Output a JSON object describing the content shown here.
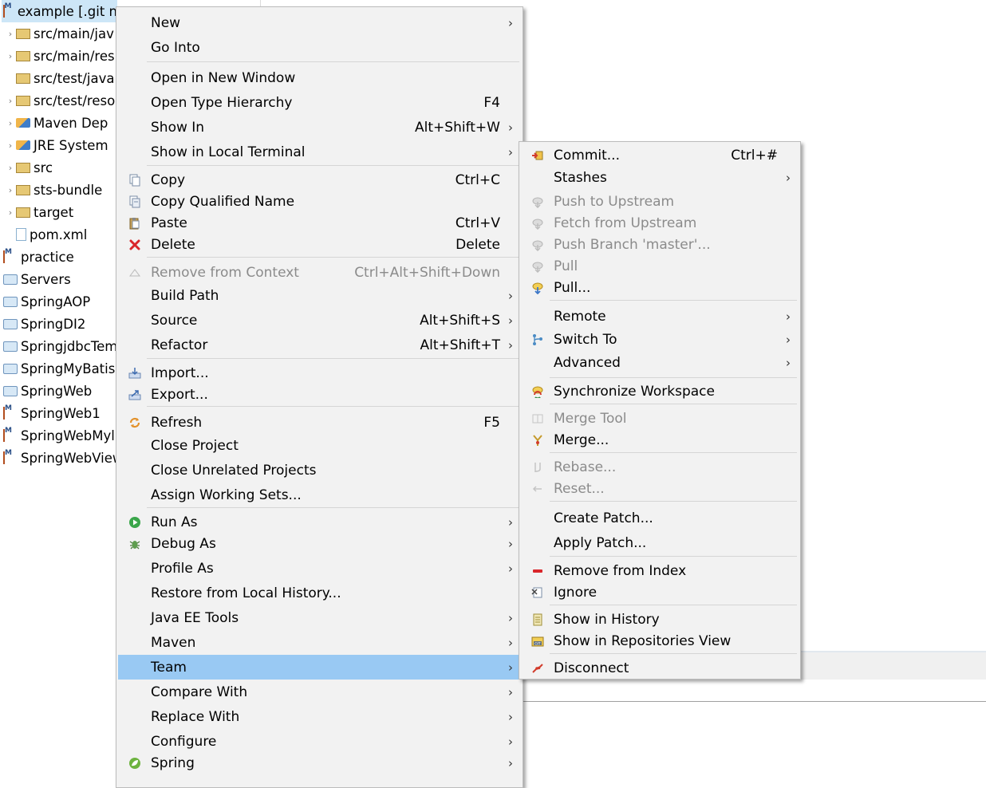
{
  "project_explorer": {
    "items": [
      {
        "label": "example [.git n",
        "kind": "maven",
        "expand": "",
        "selected": true
      },
      {
        "label": "src/main/jav",
        "kind": "folder",
        "expand": "›"
      },
      {
        "label": "src/main/res",
        "kind": "folder",
        "expand": "›"
      },
      {
        "label": "src/test/java",
        "kind": "folder",
        "expand": ""
      },
      {
        "label": "src/test/reso",
        "kind": "folder",
        "expand": "›"
      },
      {
        "label": "Maven Dep",
        "kind": "lib",
        "expand": "›"
      },
      {
        "label": "JRE System",
        "kind": "lib",
        "expand": "›"
      },
      {
        "label": "src",
        "kind": "folder",
        "expand": "›"
      },
      {
        "label": "sts-bundle",
        "kind": "folder",
        "expand": "›"
      },
      {
        "label": "target",
        "kind": "folder",
        "expand": "›"
      },
      {
        "label": "pom.xml",
        "kind": "file",
        "expand": ""
      },
      {
        "label": "practice",
        "kind": "maven",
        "expand": ""
      },
      {
        "label": "Servers",
        "kind": "project",
        "expand": ""
      },
      {
        "label": "SpringAOP",
        "kind": "project",
        "expand": ""
      },
      {
        "label": "SpringDI2",
        "kind": "project",
        "expand": ""
      },
      {
        "label": "SpringjdbcTem",
        "kind": "project",
        "expand": ""
      },
      {
        "label": "SpringMyBatis",
        "kind": "project",
        "expand": ""
      },
      {
        "label": "SpringWeb",
        "kind": "project",
        "expand": ""
      },
      {
        "label": "SpringWeb1",
        "kind": "maven",
        "expand": ""
      },
      {
        "label": "SpringWebMyl",
        "kind": "maven",
        "expand": ""
      },
      {
        "label": "SpringWebView",
        "kind": "maven",
        "expand": ""
      }
    ]
  },
  "context_menu": {
    "items": [
      {
        "label": "New",
        "submenu": true
      },
      {
        "label": "Go Into"
      },
      {
        "label": "Open in New Window"
      },
      {
        "label": "Open Type Hierarchy",
        "shortcut": "F4"
      },
      {
        "label": "Show In",
        "shortcut": "Alt+Shift+W",
        "submenu": true
      },
      {
        "label": "Show in Local Terminal",
        "submenu": true
      },
      {
        "label": "Copy",
        "shortcut": "Ctrl+C",
        "icon": "copy-icon"
      },
      {
        "label": "Copy Qualified Name",
        "icon": "copy-qualified-icon"
      },
      {
        "label": "Paste",
        "shortcut": "Ctrl+V",
        "icon": "paste-icon"
      },
      {
        "label": "Delete",
        "shortcut": "Delete",
        "icon": "delete-icon"
      },
      {
        "label": "Remove from Context",
        "shortcut": "Ctrl+Alt+Shift+Down",
        "icon": "remove-context-icon",
        "disabled": true
      },
      {
        "label": "Build Path",
        "submenu": true
      },
      {
        "label": "Source",
        "shortcut": "Alt+Shift+S",
        "submenu": true
      },
      {
        "label": "Refactor",
        "shortcut": "Alt+Shift+T",
        "submenu": true
      },
      {
        "label": "Import...",
        "icon": "import-icon"
      },
      {
        "label": "Export...",
        "icon": "export-icon"
      },
      {
        "label": "Refresh",
        "shortcut": "F5",
        "icon": "refresh-icon"
      },
      {
        "label": "Close Project"
      },
      {
        "label": "Close Unrelated Projects"
      },
      {
        "label": "Assign Working Sets..."
      },
      {
        "label": "Run As",
        "submenu": true,
        "icon": "run-icon"
      },
      {
        "label": "Debug As",
        "submenu": true,
        "icon": "debug-icon"
      },
      {
        "label": "Profile As",
        "submenu": true
      },
      {
        "label": "Restore from Local History..."
      },
      {
        "label": "Java EE Tools",
        "submenu": true
      },
      {
        "label": "Maven",
        "submenu": true
      },
      {
        "label": "Team",
        "submenu": true,
        "highlighted": true
      },
      {
        "label": "Compare With",
        "submenu": true
      },
      {
        "label": "Replace With",
        "submenu": true
      },
      {
        "label": "Configure",
        "submenu": true
      },
      {
        "label": "Spring",
        "submenu": true,
        "icon": "spring-icon"
      }
    ]
  },
  "team_menu": {
    "items": [
      {
        "label": "Commit...",
        "shortcut": "Ctrl+#",
        "icon": "commit-icon"
      },
      {
        "label": "Stashes",
        "submenu": true
      },
      {
        "label": "Push to Upstream",
        "icon": "push-icon",
        "disabled": true
      },
      {
        "label": "Fetch from Upstream",
        "icon": "fetch-icon",
        "disabled": true
      },
      {
        "label": "Push Branch 'master'...",
        "icon": "push-branch-icon",
        "disabled": true
      },
      {
        "label": "Pull",
        "icon": "pull-icon",
        "disabled": true
      },
      {
        "label": "Pull...",
        "icon": "pull-dialog-icon"
      },
      {
        "label": "Remote",
        "submenu": true
      },
      {
        "label": "Switch To",
        "submenu": true,
        "icon": "switch-branch-icon"
      },
      {
        "label": "Advanced",
        "submenu": true
      },
      {
        "label": "Synchronize Workspace",
        "icon": "synchronize-icon"
      },
      {
        "label": "Merge Tool",
        "icon": "merge-tool-icon",
        "disabled": true
      },
      {
        "label": "Merge...",
        "icon": "merge-icon"
      },
      {
        "label": "Rebase...",
        "icon": "rebase-icon",
        "disabled": true
      },
      {
        "label": "Reset...",
        "icon": "reset-icon",
        "disabled": true
      },
      {
        "label": "Create Patch..."
      },
      {
        "label": "Apply Patch..."
      },
      {
        "label": "Remove from Index",
        "icon": "remove-index-icon"
      },
      {
        "label": "Ignore",
        "icon": "ignore-icon"
      },
      {
        "label": "Show in History",
        "icon": "history-icon"
      },
      {
        "label": "Show in Repositories View",
        "icon": "repositories-icon"
      },
      {
        "label": "Disconnect",
        "icon": "disconnect-icon"
      }
    ]
  },
  "colors": {
    "menu_bg": "#f2f2f2",
    "highlight": "#99c9f3",
    "disabled_text": "#8b8b8b",
    "selection": "#cde6f7"
  }
}
